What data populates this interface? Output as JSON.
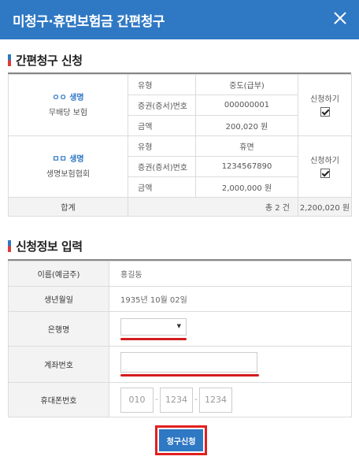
{
  "header": {
    "title": "미청구·휴면보험금 간편청구"
  },
  "section1": {
    "title": "간편청구 신청"
  },
  "claims": [
    {
      "insurer_name": "ㅇㅇ 생명",
      "product": "무배당 보험",
      "type_label": "유형",
      "type_value": "중도(급부)",
      "policy_label": "증권(증서)번호",
      "policy_value": "000000001",
      "amount_label": "금액",
      "amount_value": "200,020 원",
      "apply_label": "신청하기",
      "apply_checked": true
    },
    {
      "insurer_name": "ㅁㅁ 생명",
      "product": "생명보험협회",
      "type_label": "유형",
      "type_value": "휴면",
      "policy_label": "증권(증서)번호",
      "policy_value": "1234567890",
      "amount_label": "금액",
      "amount_value": "2,000,000 원",
      "apply_label": "신청하기",
      "apply_checked": true
    }
  ],
  "summary": {
    "label": "합계",
    "count": "총 2 건",
    "total": "2,200,020 원"
  },
  "section2": {
    "title": "신청정보 입력"
  },
  "form": {
    "name_label": "이름(예금주)",
    "name_value": "홍길동",
    "birth_label": "생년월일",
    "birth_value": "1935년 10월 02일",
    "bank_label": "은행명",
    "bank_value": "",
    "account_label": "계좌번호",
    "account_value": "",
    "phone_label": "휴대폰번호",
    "phone": [
      "010",
      "1234",
      "1234"
    ]
  },
  "submit": {
    "label": "청구신청"
  },
  "colors": {
    "brand": "#2f78c4",
    "highlight": "#d21c1c"
  }
}
